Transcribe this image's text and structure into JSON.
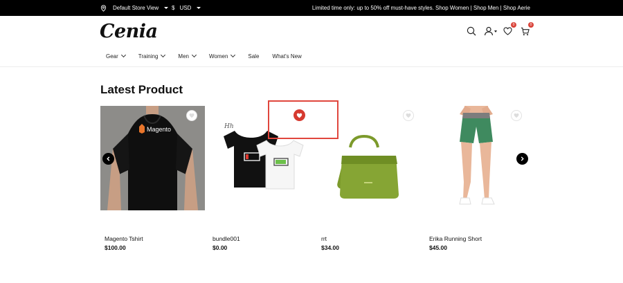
{
  "topbar": {
    "store_label": "Default Store View",
    "currency_symbol": "$",
    "currency_label": "USD",
    "promo_text": "Limited time only: up to 50% off must-have styles. Shop Women | Shop Men | Shop Aerie"
  },
  "header": {
    "logo_text": "Cenia",
    "wishlist_count": "0",
    "cart_count": "0"
  },
  "nav": {
    "items": [
      {
        "label": "Gear"
      },
      {
        "label": "Training"
      },
      {
        "label": "Men"
      },
      {
        "label": "Women"
      },
      {
        "label": "Sale"
      },
      {
        "label": "What's New"
      }
    ]
  },
  "section": {
    "title": "Latest Product"
  },
  "products": [
    {
      "name": "Magento Tshirt",
      "price": "$100.00",
      "image_text": "Magento"
    },
    {
      "name": "bundle001",
      "price": "$0.00"
    },
    {
      "name": "rrt",
      "price": "$34.00"
    },
    {
      "name": "Erika Running Short",
      "price": "$45.00"
    }
  ],
  "colors": {
    "topbar_bg": "#000000",
    "accent_red": "#d63a30"
  }
}
